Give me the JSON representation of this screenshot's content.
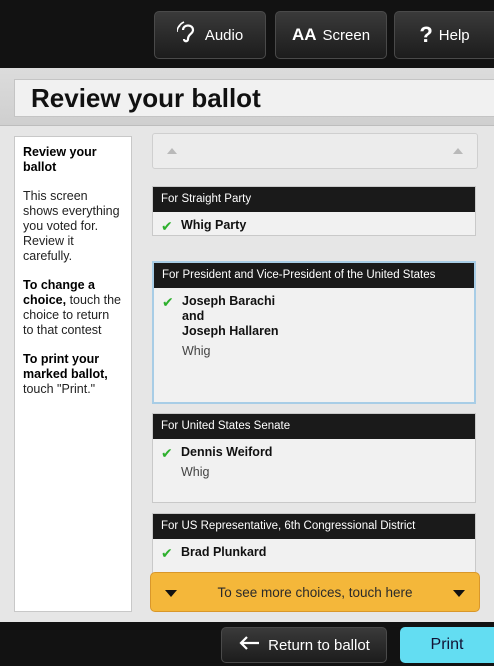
{
  "header": {
    "audio_label": "Audio",
    "screen_label": "Screen",
    "screen_icon_text": "AA",
    "help_label": "Help",
    "help_icon_text": "?"
  },
  "page_title": "Review your ballot",
  "instructions": {
    "heading": "Review your ballot",
    "intro": "This screen shows everything you voted for. Review it carefully.",
    "change_bold": "To change a choice,",
    "change_rest": "touch the choice to return to that contest",
    "print_bold": "To print your marked ballot,",
    "print_rest": "touch \"Print.\""
  },
  "contests": [
    {
      "title": "For Straight Party",
      "choice_lines": [
        "Whig Party"
      ],
      "party": ""
    },
    {
      "title": "For President and Vice-President of the United States",
      "choice_lines": [
        "Joseph Barachi",
        "and",
        "Joseph Hallaren"
      ],
      "party": "Whig"
    },
    {
      "title": "For United States Senate",
      "choice_lines": [
        "Dennis Weiford"
      ],
      "party": "Whig"
    },
    {
      "title": "For US Representative, 6th Congressional District",
      "choice_lines": [
        "Brad Plunkard"
      ],
      "party": ""
    }
  ],
  "more_choices_label": "To see more choices, touch here",
  "footer": {
    "return_label": "Return to ballot",
    "print_label": "Print"
  },
  "colors": {
    "check": "#2db02d",
    "more_bar": "#f4b73a",
    "print_button": "#63ddf2",
    "selected_border": "#a8cde6"
  }
}
